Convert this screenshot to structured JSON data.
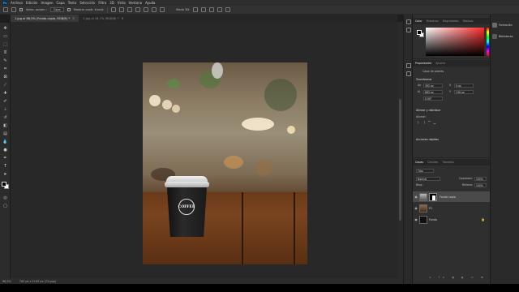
{
  "menu": {
    "logo": "Ps",
    "items": [
      "Archivo",
      "Edición",
      "Imagen",
      "Capa",
      "Texto",
      "Selección",
      "Filtro",
      "3D",
      "Vista",
      "Ventana",
      "Ayuda"
    ]
  },
  "options": {
    "auto_select_label": "Selec. autom.:",
    "auto_select_value": "Capa",
    "show_transform_label": "Mostrar contr. transf.",
    "mode_3d_label": "Modo 3D:"
  },
  "tabs": [
    {
      "label": "1.jpg al 66,5% (Fondo copia, RGB/8) *",
      "active": true
    },
    {
      "label": "2.jpg al 16,7% (RGB/8) *",
      "active": false
    }
  ],
  "status": {
    "zoom": "66,5%",
    "doc_info": "762 px x 1142 px (72 ppp)"
  },
  "colors": {
    "app_bg": "#1e1e1e",
    "panel_bg": "#2f2f2f",
    "accent": "#31a8ff"
  },
  "photo": {
    "logo_text": "COFFEE"
  },
  "color_panel": {
    "tabs": [
      "Color",
      "Muestras",
      "Degradados",
      "Motivos"
    ]
  },
  "properties_panel": {
    "tabs": [
      "Propiedades",
      "Ajustes"
    ],
    "layer_type": "Capa de píxeles",
    "transform_title": "Transformar",
    "w": "392 px",
    "h": "883 px",
    "x": "0 px",
    "y": "136 px",
    "angle": "0,00°",
    "align_title": "Alinear y distribuir",
    "align_label": "Alinear:",
    "quick_actions_title": "Acciones rápidas"
  },
  "layers_panel": {
    "tabs": [
      "Capas",
      "Canales",
      "Trazados"
    ],
    "filter_kind": "Tipo",
    "blend_mode": "Normal",
    "opacity_label": "Opacidad:",
    "opacity_value": "100%",
    "lock_label": "Bloq.:",
    "fill_label": "Relleno:",
    "fill_value": "100%",
    "layers": [
      {
        "name": "Fondo copia",
        "selected": true
      },
      {
        "name": "P1",
        "selected": false
      },
      {
        "name": "Fondo",
        "selected": false
      }
    ]
  },
  "libraries": {
    "items": [
      "Formación",
      "Bibliotecas"
    ]
  }
}
